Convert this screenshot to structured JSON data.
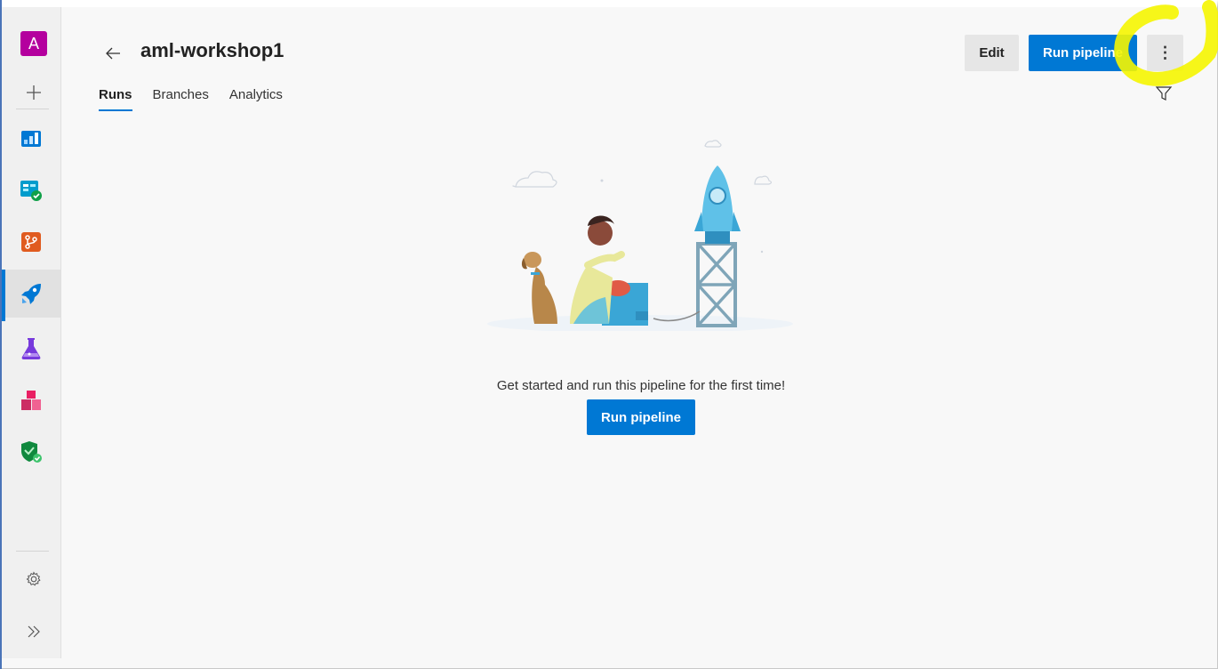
{
  "app": {
    "avatar_letter": "A"
  },
  "sidebar": {
    "items": [
      {
        "name": "overview-icon",
        "color": "#0078d4"
      },
      {
        "name": "boards-icon",
        "color": "#009ccc"
      },
      {
        "name": "repos-icon",
        "color": "#e05b1f"
      },
      {
        "name": "pipelines-icon",
        "color": "#0078d4"
      },
      {
        "name": "test-plans-icon",
        "color": "#773adc"
      },
      {
        "name": "artifacts-icon",
        "color": "#cc2e64"
      },
      {
        "name": "security-icon",
        "color": "#10893e"
      }
    ],
    "active_index": 3
  },
  "header": {
    "title": "aml-workshop1",
    "tabs": [
      {
        "label": "Runs",
        "active": true
      },
      {
        "label": "Branches",
        "active": false
      },
      {
        "label": "Analytics",
        "active": false
      }
    ],
    "edit_label": "Edit",
    "run_label": "Run pipeline",
    "more_label": "⋮"
  },
  "empty_state": {
    "message": "Get started and run this pipeline for the first time!",
    "button_label": "Run pipeline"
  },
  "colors": {
    "accent": "#0078d4",
    "highlight": "#f5f500"
  }
}
